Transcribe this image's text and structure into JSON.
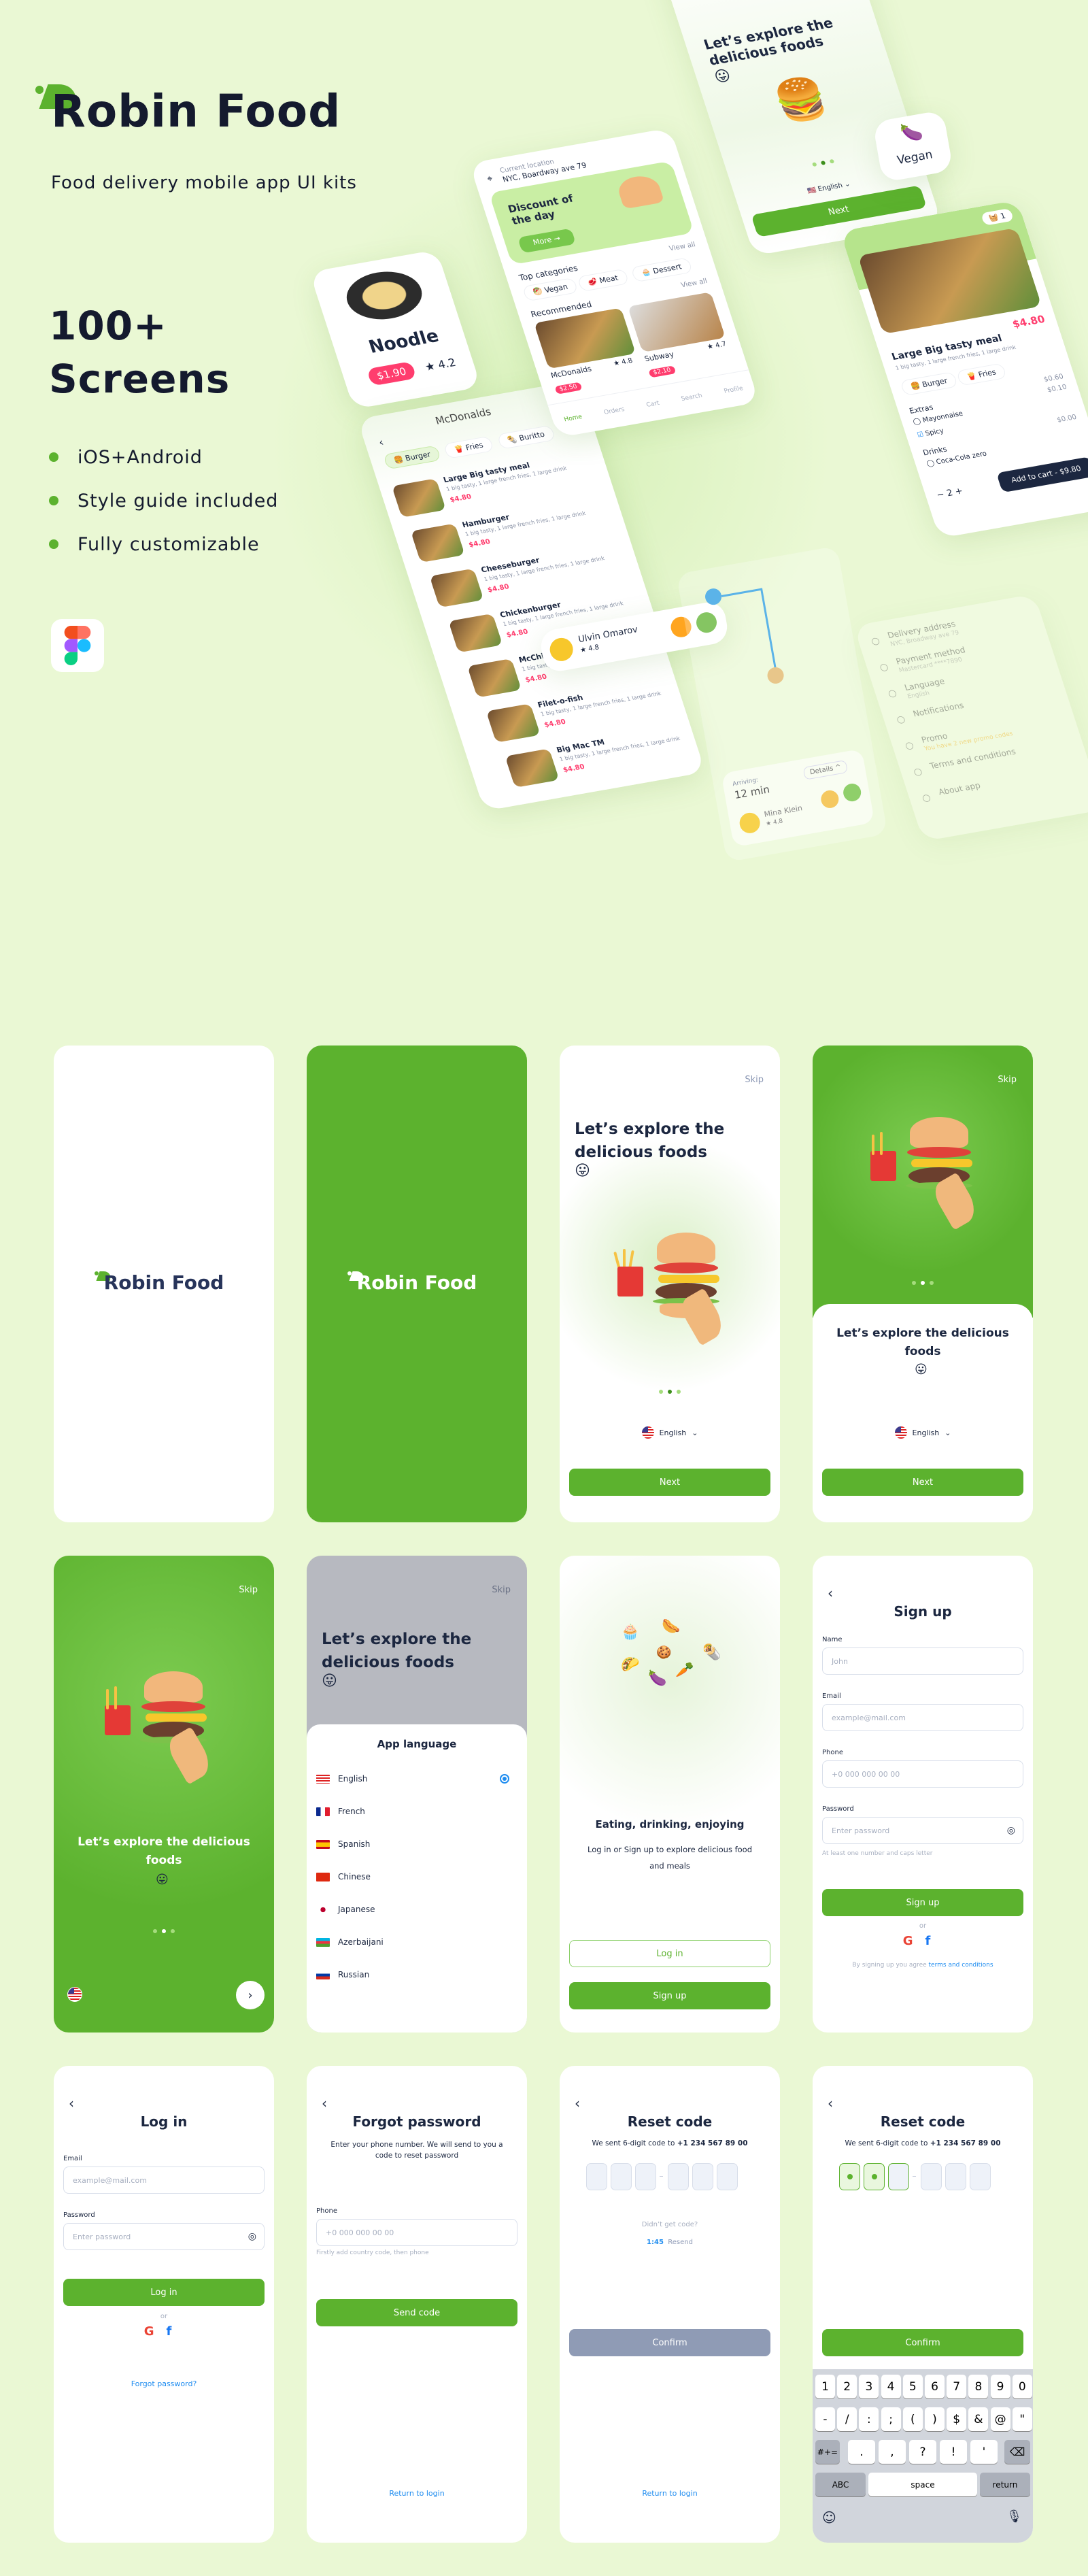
{
  "hero": {
    "brand": "Robin Food",
    "subtitle": "Food delivery mobile app UI kits",
    "count": "100+",
    "count_label": "Screens",
    "bullets": [
      "iOS+Android",
      "Style guide included",
      "Fully customizable"
    ],
    "tool_icon": "figma-icon"
  },
  "colors": {
    "background": "#eaf8d4",
    "brand_green": "#5cb22e",
    "navy": "#1c2740",
    "price_pink": "#ff3d6e",
    "link_blue": "#1e8cf0",
    "disabled": "#8f9bb5"
  },
  "mockups": {
    "noodle": {
      "name": "Noodle",
      "price": "$1.90",
      "rating": "4.2"
    },
    "menu": {
      "title": "McDonalds",
      "chips": [
        "Burger",
        "Fries",
        "Buritto"
      ],
      "items": [
        {
          "name": "Large Big tasty meal",
          "desc": "1 big tasty, 1 large french fries, 1 large drink",
          "price": "$4.80"
        },
        {
          "name": "Hamburger",
          "desc": "1 big tasty, 1 large french fries, 1 large drink",
          "price": "$4.80"
        },
        {
          "name": "Cheeseburger",
          "desc": "1 big tasty, 1 large french fries, 1 large drink",
          "price": "$4.80"
        },
        {
          "name": "Chickenburger",
          "desc": "1 big tasty, 1 large french fries, 1 large drink",
          "price": "$4.80"
        },
        {
          "name": "McChicken TM",
          "desc": "1 big tasty, 1 large french fries, 1 large drink",
          "price": "$4.80"
        },
        {
          "name": "Filet-o-fish",
          "desc": "1 big tasty, 1 large french fries, 1 large drink",
          "price": "$4.80"
        },
        {
          "name": "Big Mac TM",
          "desc": "1 big tasty, 1 large french fries, 1 large drink",
          "price": "$4.80"
        }
      ]
    },
    "home": {
      "location_label": "Current location",
      "location": "NYC, Boardway ave 79",
      "banner_title": "Discount of the day",
      "banner_button": "More →",
      "top_categories": "Top categories",
      "view_all": "View all",
      "categories": [
        "Vegan",
        "Meat",
        "Dessert"
      ],
      "recommended": "Recommended",
      "restaurants": [
        {
          "name": "McDonalds",
          "rating": "4.8",
          "price": "$2.50"
        },
        {
          "name": "Subway",
          "rating": "4.7",
          "price": "$2.10"
        }
      ],
      "nav": [
        "Home",
        "Orders",
        "Cart",
        "Search",
        "Profile"
      ]
    },
    "onboarding": {
      "title": "Let’s explore the delicious foods",
      "emoji": "😛",
      "language": "English",
      "next": "Next"
    },
    "category_card": {
      "emoji": "🍆",
      "label": "Vegan"
    },
    "product": {
      "cart_count": "1",
      "name": "Large Big tasty meal",
      "desc": "1 big tasty, 1 large french fries, 1 large drink",
      "price": "$4.80",
      "chips": [
        "Burger",
        "Fries"
      ],
      "extras_title": "Extras",
      "extras": [
        {
          "name": "Mayonnaise",
          "price": "$0.60",
          "checked": false
        },
        {
          "name": "Spicy",
          "price": "$0.10",
          "checked": true
        }
      ],
      "drinks_title": "Drinks",
      "drinks": [
        {
          "name": "Coca-Cola zero",
          "price": "$0.00",
          "checked": false
        }
      ],
      "quantity": "2",
      "add_to_cart": "Add to cart - $9.80"
    },
    "courier": {
      "name": "Ulvin Omarov",
      "rating": "4.8"
    },
    "tracking": {
      "arriving_label": "Arriving:",
      "eta": "12 min",
      "details": "Details",
      "courier": "Mina Klein",
      "rating": "4.8"
    },
    "profile": {
      "items": [
        {
          "title": "Delivery address",
          "sub": "NYC, Broadway ave 79"
        },
        {
          "title": "Payment method",
          "sub": "Mastercard ****7890"
        },
        {
          "title": "Language",
          "sub": "English"
        },
        {
          "title": "Notifications",
          "sub": ""
        },
        {
          "title": "Promo",
          "sub": "You have 2 new promo codes"
        },
        {
          "title": "Terms and conditions",
          "sub": ""
        },
        {
          "title": "About app",
          "sub": ""
        }
      ],
      "nav_active": "Profile"
    }
  },
  "screens": {
    "splash_light": {
      "brand": "Robin Food"
    },
    "splash_green": {
      "brand": "Robin Food"
    },
    "onboard1": {
      "skip": "Skip",
      "title": "Let’s explore the delicious foods",
      "emoji": "😛",
      "language": "English",
      "next": "Next",
      "active_dot": 2
    },
    "onboard2": {
      "skip": "Skip",
      "title": "Let’s explore the delicious foods",
      "emoji": "😛",
      "language": "English",
      "next": "Next",
      "active_dot": 2
    },
    "onboard3": {
      "skip": "Skip",
      "title": "Let’s explore the delicious foods",
      "emoji": "😛",
      "next_icon": "chevron-right-icon",
      "active_dot": 2
    },
    "language_sheet": {
      "skip": "Skip",
      "title": "Let’s explore the delicious foods",
      "emoji": "😛",
      "sheet_title": "App language",
      "selected": "English",
      "languages": [
        "English",
        "French",
        "Spanish",
        "Chinese",
        "Japanese",
        "Azerbaijani",
        "Russian"
      ]
    },
    "welcome": {
      "title": "Eating, drinking, enjoying",
      "text": "Log in or Sign up to explore delicious food and meals",
      "login": "Log in",
      "signup": "Sign up"
    },
    "signup": {
      "title": "Sign up",
      "name_label": "Name",
      "name_placeholder": "John",
      "email_label": "Email",
      "email_placeholder": "example@mail.com",
      "phone_label": "Phone",
      "phone_placeholder": "+0 000 000 00 00",
      "password_label": "Password",
      "password_placeholder": "Enter password",
      "hint": "At least one number and caps letter",
      "button": "Sign up",
      "or": "or",
      "terms_prefix": "By signing up you agree",
      "terms_link": "terms and conditions"
    },
    "login": {
      "title": "Log in",
      "email_label": "Email",
      "email_placeholder": "example@mail.com",
      "password_label": "Password",
      "password_placeholder": "Enter password",
      "button": "Log in",
      "or": "or",
      "forgot": "Forgot password?"
    },
    "forgot": {
      "title": "Forgot password",
      "text": "Enter your phone number. We will send to you a code to reset password",
      "phone_label": "Phone",
      "phone_placeholder": "+0 000 000 00 00",
      "hint": "Firstly add country code, then phone",
      "button": "Send code",
      "return": "Return to login"
    },
    "reset1": {
      "title": "Reset code",
      "text_prefix": "We sent 6-digit code to",
      "phone": "+1 234 567 89 00",
      "didnt_get": "Didn’t get code?",
      "timer": "1:45",
      "resend": "Resend",
      "button": "Confirm",
      "return": "Return to login"
    },
    "reset2": {
      "title": "Reset code",
      "text_prefix": "We sent 6-digit code to",
      "phone": "+1 234 567 89 00",
      "filled_digits": 2,
      "button": "Confirm",
      "keyboard": {
        "row1": [
          "1",
          "2",
          "3",
          "4",
          "5",
          "6",
          "7",
          "8",
          "9",
          "0"
        ],
        "row2": [
          "-",
          "/",
          ":",
          ";",
          "(",
          ")",
          "$",
          "&",
          "@",
          "\""
        ],
        "row3": [
          ".",
          ",",
          "?",
          "!",
          "'"
        ],
        "symbols": "#+=",
        "abc": "ABC",
        "space": "space",
        "return": "return"
      }
    }
  }
}
